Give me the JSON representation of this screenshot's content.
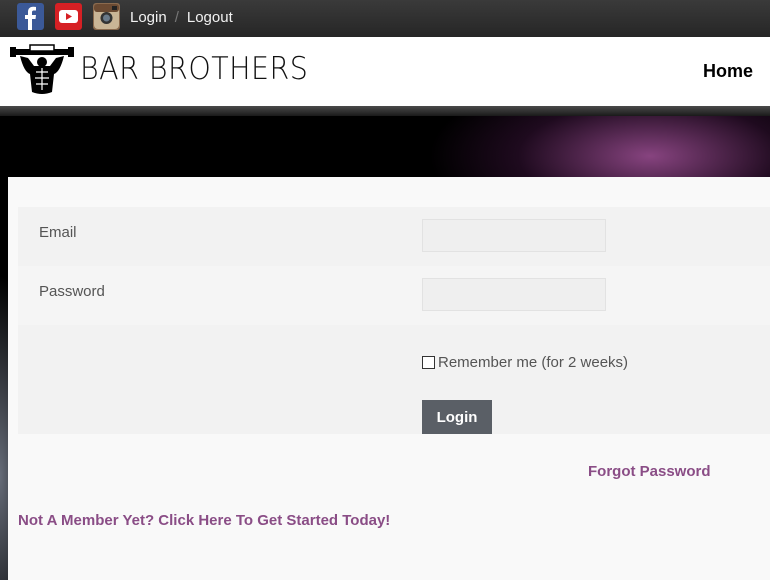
{
  "topbar": {
    "social": [
      {
        "icon": "facebook-icon",
        "color": "#3b5998"
      },
      {
        "icon": "youtube-icon",
        "color": "#d62024"
      },
      {
        "icon": "instagram-icon",
        "color": "#8a6a4e"
      }
    ],
    "login_label": "Login",
    "separator": "/",
    "logout_label": "Logout"
  },
  "header": {
    "brand": "BAR BROTHERS",
    "nav_home": "Home"
  },
  "form": {
    "email_label": "Email",
    "email_value": "",
    "password_label": "Password",
    "password_value": "",
    "remember_label": "Remember me (for 2 weeks)",
    "remember_checked": false,
    "login_button": "Login"
  },
  "links": {
    "forgot_password": "Forgot Password",
    "signup": "Not A Member Yet? Click Here To Get Started Today!"
  },
  "colors": {
    "link": "#8a4d86",
    "button": "#5a5f66",
    "topbar": "#2c2c2c"
  }
}
